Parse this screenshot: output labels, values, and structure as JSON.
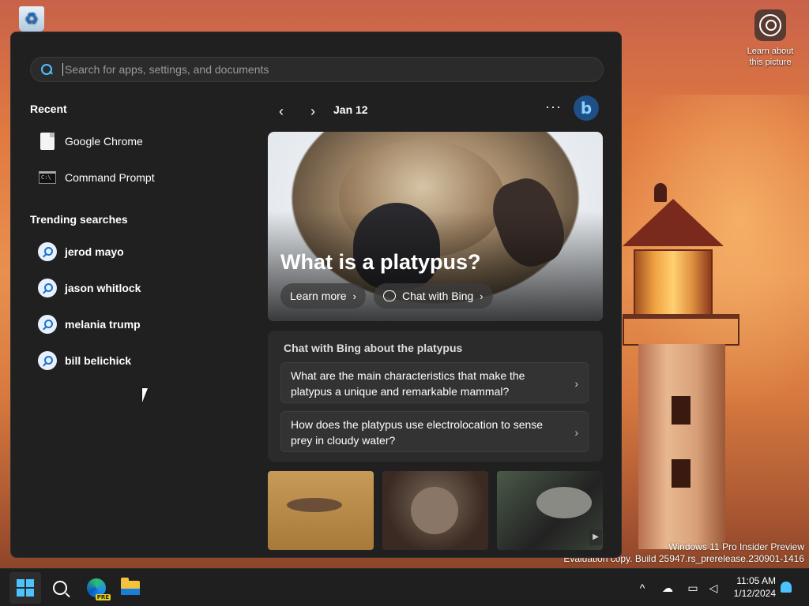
{
  "desktop": {
    "learn_label": "Learn about this picture",
    "watermark_line1": "Windows 11 Pro Insider Preview",
    "watermark_line2": "Evaluation copy. Build 25947.rs_prerelease.230901-1416"
  },
  "search": {
    "placeholder": "Search for apps, settings, and documents"
  },
  "recent": {
    "title": "Recent",
    "items": [
      {
        "label": "Google Chrome",
        "icon": "file-icon"
      },
      {
        "label": "Command Prompt",
        "icon": "cmd-icon"
      }
    ]
  },
  "trending": {
    "title": "Trending searches",
    "items": [
      {
        "label": "jerod mayo"
      },
      {
        "label": "jason whitlock"
      },
      {
        "label": "melania trump"
      },
      {
        "label": "bill belichick"
      }
    ]
  },
  "highlights": {
    "date": "Jan 12",
    "more": "···",
    "hero_title": "What is a platypus?",
    "learn_more": "Learn more",
    "chat_with_bing": "Chat with Bing",
    "chat_card_title": "Chat with Bing about the platypus",
    "questions": [
      {
        "text": "What are the main characteristics that make the platypus a unique and remarkable mammal?"
      },
      {
        "text": "How does the platypus use electrolocation to sense prey in cloudy water?"
      }
    ]
  },
  "taskbar": {
    "time": "11:05 AM",
    "date": "1/12/2024"
  },
  "colors": {
    "accent": "#4cc2ff",
    "panel_bg": "#202020"
  }
}
